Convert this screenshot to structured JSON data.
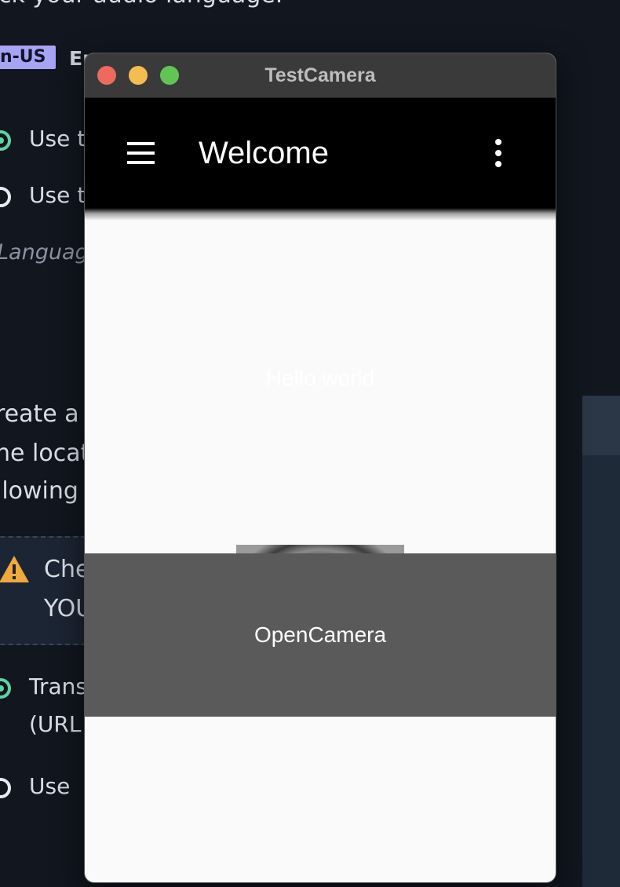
{
  "background": {
    "heading_fragment": "ck your audio language.",
    "lang_code": "n-US",
    "lang_name_fragment": "Er",
    "radio_options": [
      "Use t",
      "Use t"
    ],
    "language_hint": "Languag",
    "paragraph_lines": [
      "reate a",
      "ne locat",
      "llowing"
    ],
    "warning_lines": [
      "Che",
      "YOU"
    ],
    "bottom_options": [
      {
        "line1": "Trans",
        "line2": "(URL"
      },
      {
        "line1": "Use",
        "line2": ""
      }
    ],
    "colors": {
      "page_bg": "#11161f",
      "lang_tag_bg": "#a7a4f3",
      "radio_selected": "#5fd3a0",
      "warning": "#f0a93c"
    }
  },
  "window": {
    "title": "TestCamera",
    "traffic_lights": [
      "close",
      "minimize",
      "maximize"
    ]
  },
  "appbar": {
    "menu_icon": "hamburger-menu-icon",
    "title": "Welcome",
    "more_icon": "more-vertical-icon"
  },
  "content": {
    "hello_text": "Hello world",
    "image": "camera-shutter-aperture"
  },
  "bottom_button": {
    "label": "OpenCamera",
    "bg": "#5a5a5a"
  }
}
